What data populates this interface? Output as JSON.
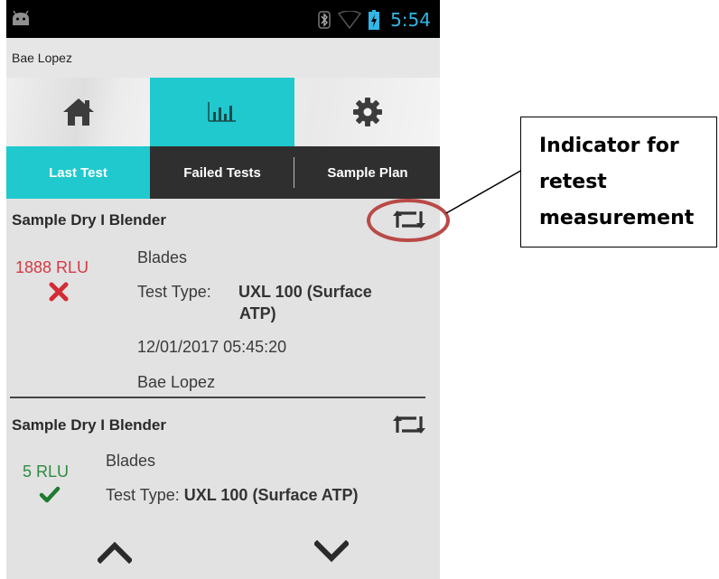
{
  "status_bar": {
    "time": "5:54",
    "icons": [
      "android-icon",
      "bluetooth-icon",
      "wifi-icon",
      "battery-icon"
    ]
  },
  "user": {
    "name": "Bae Lopez"
  },
  "nav": {
    "items": [
      {
        "icon": "home-icon",
        "active": false
      },
      {
        "icon": "chart-icon",
        "active": true
      },
      {
        "icon": "gear-icon",
        "active": false
      }
    ]
  },
  "tabs": [
    {
      "label": "Last Test",
      "active": true
    },
    {
      "label": "Failed Tests",
      "active": false
    },
    {
      "label": "Sample Plan",
      "active": false
    }
  ],
  "records": [
    {
      "title": "Sample Dry I Blender",
      "rlu": "1888 RLU",
      "status": "fail",
      "location": "Blades",
      "test_type_label": "Test Type:",
      "test_type_value_1": "UXL 100 (Surface",
      "test_type_value_2": "ATP)",
      "datetime": "12/01/2017 05:45:20",
      "user": "Bae Lopez"
    },
    {
      "title": "Sample Dry I Blender",
      "rlu": "5 RLU",
      "status": "pass",
      "location": "Blades",
      "test_type_label": "Test Type:",
      "test_type_value": "UXL 100 (Surface ATP)"
    }
  ],
  "annotation": {
    "text": "Indicator for\nretest\nmeasurement"
  },
  "colors": {
    "accent": "#1fc9ce",
    "fail": "#d43a45",
    "pass": "#2e8b3e",
    "highlight": "#b94a48"
  }
}
